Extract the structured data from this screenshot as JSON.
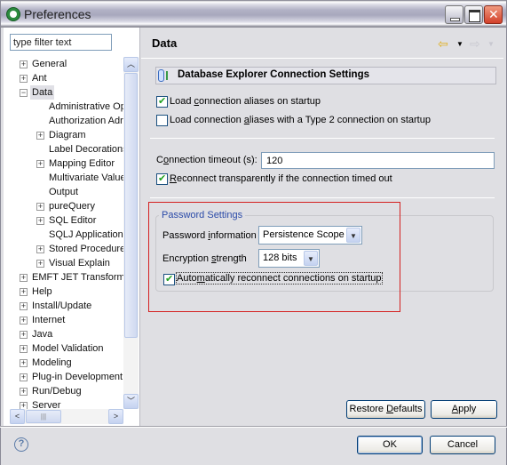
{
  "window": {
    "title": "Preferences",
    "icons": {
      "app": "eclipse-app-icon",
      "minimize": "minimize-icon",
      "maximize": "maximize-icon",
      "close": "close-icon"
    }
  },
  "sidebar": {
    "filter_placeholder": "type filter text",
    "filter_value": "type filter text",
    "tree": [
      {
        "label": "General",
        "level": 0,
        "expandable": true,
        "expanded": false
      },
      {
        "label": "Ant",
        "level": 0,
        "expandable": true,
        "expanded": false
      },
      {
        "label": "Data",
        "level": 0,
        "expandable": true,
        "expanded": true,
        "selected": true
      },
      {
        "label": "Administrative Op",
        "level": 1,
        "expandable": false
      },
      {
        "label": "Authorization Adr",
        "level": 1,
        "expandable": false
      },
      {
        "label": "Diagram",
        "level": 1,
        "expandable": true
      },
      {
        "label": "Label Decorations",
        "level": 1,
        "expandable": false
      },
      {
        "label": "Mapping Editor",
        "level": 1,
        "expandable": true
      },
      {
        "label": "Multivariate Value",
        "level": 1,
        "expandable": false
      },
      {
        "label": "Output",
        "level": 1,
        "expandable": false
      },
      {
        "label": "pureQuery",
        "level": 1,
        "expandable": true
      },
      {
        "label": "SQL Editor",
        "level": 1,
        "expandable": true
      },
      {
        "label": "SQLJ Applications",
        "level": 1,
        "expandable": false
      },
      {
        "label": "Stored Procedure",
        "level": 1,
        "expandable": true
      },
      {
        "label": "Visual Explain",
        "level": 1,
        "expandable": true
      },
      {
        "label": "EMFT JET Transforma",
        "level": 0,
        "expandable": true
      },
      {
        "label": "Help",
        "level": 0,
        "expandable": true
      },
      {
        "label": "Install/Update",
        "level": 0,
        "expandable": true
      },
      {
        "label": "Internet",
        "level": 0,
        "expandable": true
      },
      {
        "label": "Java",
        "level": 0,
        "expandable": true
      },
      {
        "label": "Model Validation",
        "level": 0,
        "expandable": true
      },
      {
        "label": "Modeling",
        "level": 0,
        "expandable": true
      },
      {
        "label": "Plug-in Development",
        "level": 0,
        "expandable": true
      },
      {
        "label": "Run/Debug",
        "level": 0,
        "expandable": true
      },
      {
        "label": "Server",
        "level": 0,
        "expandable": true
      }
    ]
  },
  "page": {
    "title": "Data",
    "nav_back": "⇦",
    "nav_forward": "⇨",
    "section_title": "Database Explorer Connection Settings",
    "checks": [
      {
        "label_pre": "Load ",
        "label_u": "c",
        "label_post": "onnection aliases on startup",
        "checked": true
      },
      {
        "label_pre": "Load connection ",
        "label_u": "a",
        "label_post": "liases with a Type 2 connection on startup",
        "checked": false
      }
    ],
    "timeout_label_pre": "C",
    "timeout_label_u": "o",
    "timeout_label_post": "nnection timeout (s):",
    "timeout_value": "120",
    "reconnect": {
      "label_u": "R",
      "label_post": "econnect transparently if the connection timed out",
      "checked": true
    },
    "password_group": {
      "title": "Password Settings",
      "info_label_pre": "Password ",
      "info_label_u": "i",
      "info_label_post": "nformation",
      "info_value": "Persistence Scope",
      "strength_label_pre": "Encryption ",
      "strength_label_u": "s",
      "strength_label_post": "trength",
      "strength_value": "128 bits",
      "auto_pre": "Auto",
      "auto_u": "m",
      "auto_post": "atically reconnect connections on startup",
      "auto_checked": true
    },
    "restore_pre": "Restore ",
    "restore_u": "D",
    "restore_post": "efaults",
    "apply_u": "A",
    "apply_post": "pply"
  },
  "footer": {
    "ok": "OK",
    "cancel": "Cancel",
    "help": "?"
  },
  "colors": {
    "highlight_box": "#d42020",
    "group_title": "#2a4aa8"
  }
}
